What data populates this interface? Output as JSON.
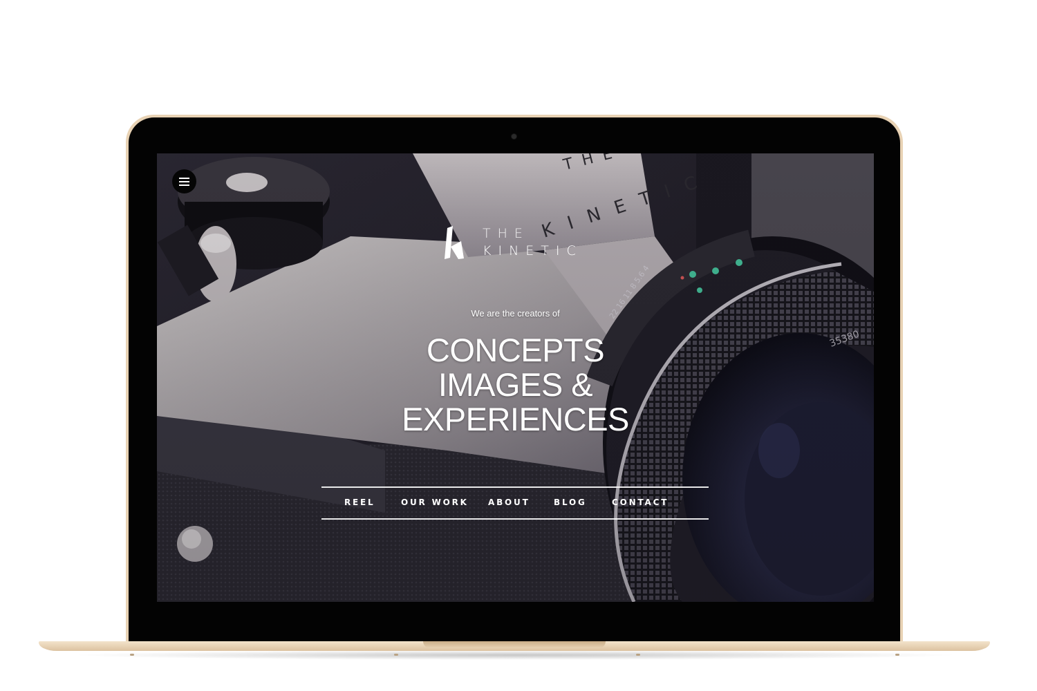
{
  "site": {
    "menu_icon": "hamburger-menu-icon",
    "logo": {
      "line1": "THE",
      "line2": "KINETIC",
      "mark": "k-logo-mark-icon"
    },
    "tagline": "We are the creators of",
    "headline": [
      "CONCEPTS",
      "IMAGES &",
      "EXPERIENCES"
    ],
    "nav": [
      {
        "label": "REEL"
      },
      {
        "label": "OUR WORK"
      },
      {
        "label": "ABOUT"
      },
      {
        "label": "BLOG"
      },
      {
        "label": "CONTACT"
      }
    ]
  },
  "colors": {
    "laptop_gold": "#e8d2b4",
    "bezel": "#030303",
    "text": "#ffffff"
  }
}
